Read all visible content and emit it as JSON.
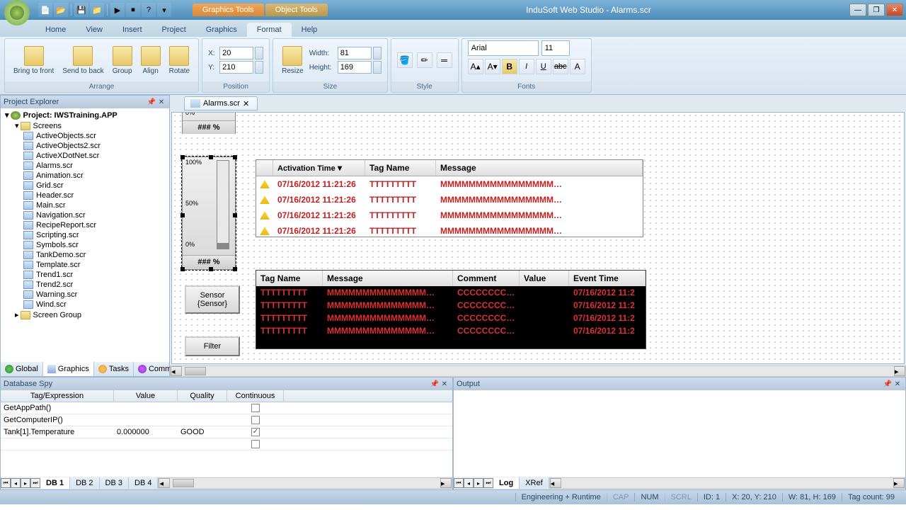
{
  "titlebar": {
    "graphics_tools": "Graphics Tools",
    "object_tools": "Object Tools",
    "app_title": "InduSoft Web Studio - Alarms.scr"
  },
  "ribbon_tabs": [
    "Home",
    "View",
    "Insert",
    "Project",
    "Graphics",
    "Format",
    "Help"
  ],
  "ribbon": {
    "arrange": {
      "label": "Arrange",
      "bring_front": "Bring to\nfront",
      "send_back": "Send to\nback",
      "group": "Group",
      "align": "Align",
      "rotate": "Rotate"
    },
    "position": {
      "label": "Position",
      "x_label": "X:",
      "y_label": "Y:",
      "x_value": "20",
      "y_value": "210"
    },
    "size": {
      "label": "Size",
      "resize": "Resize",
      "width_label": "Width:",
      "height_label": "Height:",
      "width_value": "81",
      "height_value": "169"
    },
    "style": {
      "label": "Style"
    },
    "fonts": {
      "label": "Fonts",
      "font_name": "Arial",
      "font_size": "11"
    }
  },
  "project_explorer": {
    "title": "Project Explorer",
    "root": "Project: IWSTraining.APP",
    "screens_folder": "Screens",
    "screens": [
      "ActiveObjects.scr",
      "ActiveObjects2.scr",
      "ActiveXDotNet.scr",
      "Alarms.scr",
      "Animation.scr",
      "Grid.scr",
      "Header.scr",
      "Main.scr",
      "Navigation.scr",
      "RecipeReport.scr",
      "Scripting.scr",
      "Symbols.scr",
      "TankDemo.scr",
      "Template.scr",
      "Trend1.scr",
      "Trend2.scr",
      "Warning.scr",
      "Wind.scr"
    ],
    "screen_group": "Screen Group",
    "tabs": [
      "Global",
      "Graphics",
      "Tasks",
      "Comm"
    ]
  },
  "doc_tab": "Alarms.scr",
  "gauge": {
    "t100": "100%",
    "t50": "50%",
    "t0": "0%",
    "label": "### %"
  },
  "alarm_grid1": {
    "headers": [
      "Activation Time",
      "Tag Name",
      "Message"
    ],
    "rows": [
      {
        "time": "07/16/2012 11:21:26",
        "tag": "TTTTTTTTT",
        "msg": "MMMMMMMMMMMMMMMM…"
      },
      {
        "time": "07/16/2012 11:21:26",
        "tag": "TTTTTTTTT",
        "msg": "MMMMMMMMMMMMMMMM…"
      },
      {
        "time": "07/16/2012 11:21:26",
        "tag": "TTTTTTTTT",
        "msg": "MMMMMMMMMMMMMMMM…"
      },
      {
        "time": "07/16/2012 11:21:26",
        "tag": "TTTTTTTTT",
        "msg": "MMMMMMMMMMMMMMMM…"
      }
    ]
  },
  "alarm_grid2": {
    "headers": [
      "Tag Name",
      "Message",
      "Comment",
      "Value",
      "Event Time"
    ],
    "rows": [
      {
        "tag": "TTTTTTTTT",
        "msg": "MMMMMMMMMMMMMM…",
        "comment": "CCCCCCCC…",
        "value": "",
        "time": "07/16/2012 11:2"
      },
      {
        "tag": "TTTTTTTTT",
        "msg": "MMMMMMMMMMMMMM…",
        "comment": "CCCCCCCC…",
        "value": "",
        "time": "07/16/2012 11:2"
      },
      {
        "tag": "TTTTTTTTT",
        "msg": "MMMMMMMMMMMMMM…",
        "comment": "CCCCCCCC…",
        "value": "",
        "time": "07/16/2012 11:2"
      },
      {
        "tag": "TTTTTTTTT",
        "msg": "MMMMMMMMMMMMMM…",
        "comment": "CCCCCCCC…",
        "value": "",
        "time": "07/16/2012 11:2"
      }
    ]
  },
  "sensor_btn": {
    "line1": "Sensor",
    "line2": "{Sensor}"
  },
  "filter_btn": "Filter",
  "db_spy": {
    "title": "Database Spy",
    "headers": [
      "Tag/Expression",
      "Value",
      "Quality",
      "Continuous"
    ],
    "rows": [
      {
        "tag": "GetAppPath()",
        "value": "",
        "quality": "",
        "continuous": false
      },
      {
        "tag": "GetComputerIP()",
        "value": "",
        "quality": "",
        "continuous": false
      },
      {
        "tag": "Tank[1].Temperature",
        "value": "0.000000",
        "quality": "GOOD",
        "continuous": true
      }
    ],
    "tabs": [
      "DB 1",
      "DB 2",
      "DB 3",
      "DB 4"
    ]
  },
  "output": {
    "title": "Output",
    "tabs": [
      "Log",
      "XRef"
    ]
  },
  "statusbar": {
    "mode": "Engineering + Runtime",
    "cap": "CAP",
    "num": "NUM",
    "scrl": "SCRL",
    "id": "ID: 1",
    "xy": "X: 20, Y: 210",
    "wh": "W: 81, H: 169",
    "tagcount": "Tag count: 99"
  }
}
